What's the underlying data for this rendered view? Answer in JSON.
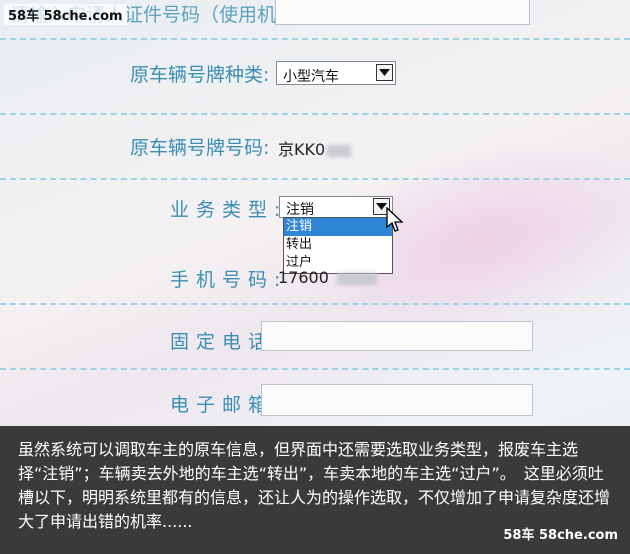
{
  "watermark": "58车  58che.com",
  "form": {
    "cert_label": "请输入申请人证件号码（使用机动车使用的证件号",
    "plate_type": {
      "label": "原车辆号牌种类:",
      "value": "小型汽车"
    },
    "plate_number": {
      "label": "原车辆号牌号码:",
      "value": "京KK0"
    },
    "business_type": {
      "label": "业务类型:",
      "value": "注销",
      "options": [
        "注销",
        "转出",
        "过户"
      ],
      "selected_index": 0
    },
    "mobile": {
      "label": "手机号码:",
      "value": "17600"
    },
    "phone": {
      "label": "固定电话:",
      "value": ""
    },
    "email": {
      "label": "电子邮箱:",
      "value": ""
    }
  },
  "caption": {
    "text": "虽然系统可以调取车主的原车信息，但界面中还需要选取业务类型，报废车主选择“注销”；车辆卖去外地的车主选“转出”，车卖本地的车主选“过户”。　这里必须吐槽以下，明明系统里都有的信息，还让人为的操作选取，不仅增加了申请复杂度还增大了申请出错的机率......",
    "logo": "58车  58che.com"
  }
}
